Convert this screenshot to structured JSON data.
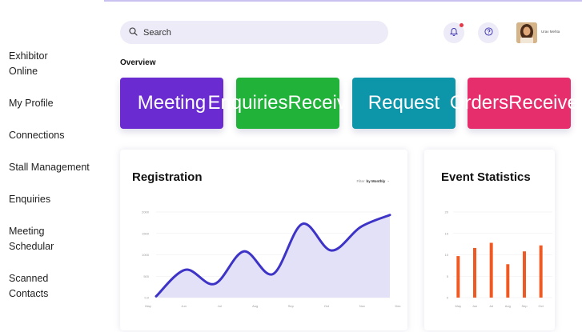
{
  "sidebar": {
    "items": [
      {
        "label": "Exhibitor Online",
        "lines": [
          "Exhibitor",
          "Online"
        ]
      },
      {
        "label": "My Profile",
        "lines": [
          "My Profile"
        ]
      },
      {
        "label": "Connections",
        "lines": [
          "Connections"
        ]
      },
      {
        "label": "Stall Management",
        "lines": [
          "Stall Management"
        ]
      },
      {
        "label": "Enquiries",
        "lines": [
          "Enquiries"
        ]
      },
      {
        "label": "Meeting Schedular",
        "lines": [
          "Meeting",
          "Schedular"
        ]
      },
      {
        "label": "Scanned Contacts",
        "lines": [
          "Scanned",
          "Contacts"
        ]
      }
    ]
  },
  "header": {
    "search_placeholder": "Search",
    "notification_icon": "bell-icon",
    "help_icon": "question-icon",
    "user_name": "Urav Mehta"
  },
  "main": {
    "section_title": "Overview",
    "cards": [
      {
        "lines": [
          "Meeting"
        ],
        "color": "#6a2bd1"
      },
      {
        "lines": [
          "Enquiries",
          "Received"
        ],
        "color": "#21b23a"
      },
      {
        "lines": [
          "Request"
        ],
        "color": "#0d95aa"
      },
      {
        "lines": [
          "Orders",
          "Received"
        ],
        "color": "#e72e6d"
      }
    ]
  },
  "chart_data": [
    {
      "type": "area",
      "title": "Registration",
      "filter_prefix": "Filter",
      "filter_value": "by Monthly",
      "x": [
        "May",
        "Jun",
        "Jul",
        "Aug",
        "Sep",
        "Oct",
        "Nov",
        "Dec"
      ],
      "y_ticks": [
        "0.0",
        "500",
        "1000",
        "1500",
        "2000"
      ],
      "ylim": [
        0,
        2000
      ],
      "series": [
        {
          "values": [
            30,
            650,
            320,
            1080,
            550,
            1720,
            1100,
            1650,
            1930
          ],
          "color": "#3d33c7",
          "fill": "#e3e1f7"
        }
      ]
    },
    {
      "type": "bar",
      "title": "Event Statistics",
      "categories": [
        "May",
        "Jun",
        "Jul",
        "Aug",
        "Sep",
        "Oct"
      ],
      "y_ticks": [
        "0",
        "5",
        "10",
        "15",
        "20"
      ],
      "ylim": [
        0,
        20
      ],
      "series": [
        {
          "values": [
            9.7,
            11.6,
            12.8,
            7.8,
            10.8,
            12.2
          ],
          "color": "#f05a22"
        }
      ]
    }
  ]
}
